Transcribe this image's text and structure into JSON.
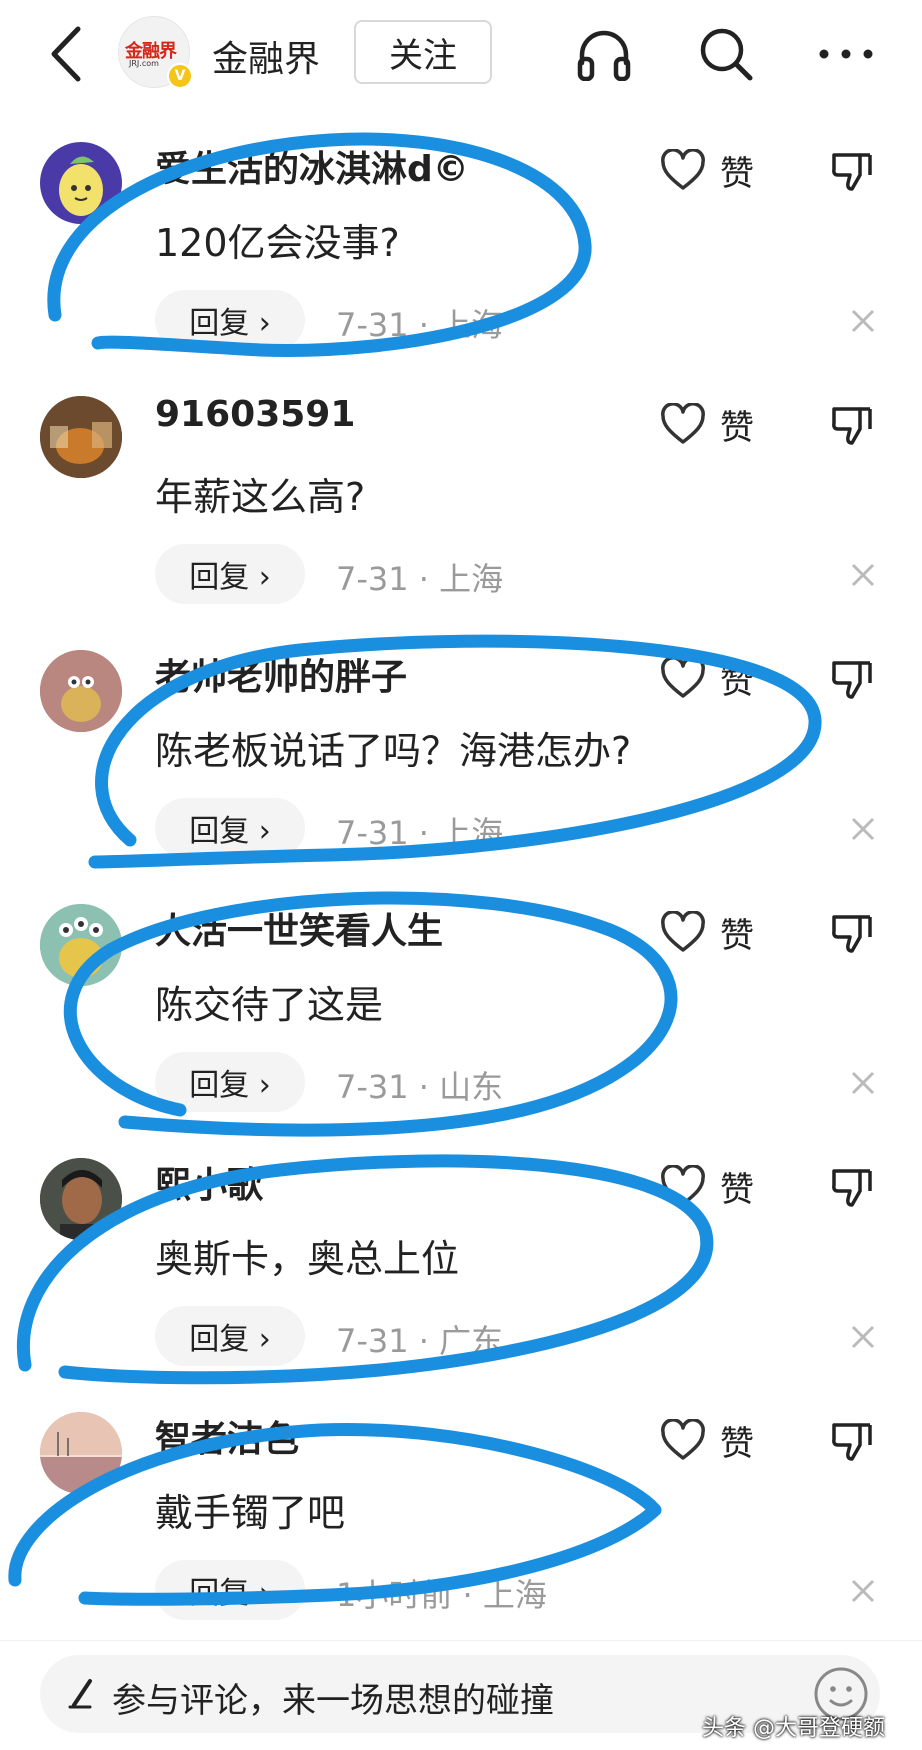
{
  "header": {
    "account_name": "金融界",
    "logo_text": "金融界",
    "logo_sub": "JRJ.com",
    "verified_badge": "V",
    "follow_label": "关注",
    "icons": [
      "back-arrow-icon",
      "headphones-icon",
      "search-icon",
      "more-icon"
    ]
  },
  "comments": [
    {
      "username": "爱生活的冰淇淋d©",
      "content": "120亿会没事?",
      "reply_label": "回复 ›",
      "meta": "7-31 · 上海",
      "like_label": "赞"
    },
    {
      "username": "91603591",
      "content": "年薪这么高?",
      "reply_label": "回复 ›",
      "meta": "7-31 · 上海",
      "like_label": "赞"
    },
    {
      "username": "老帅老帅的胖子",
      "content": "陈老板说话了吗？海港怎办?",
      "reply_label": "回复 ›",
      "meta": "7-31 · 上海",
      "like_label": "赞"
    },
    {
      "username": "人活一世笑看人生",
      "content": "陈交待了这是",
      "reply_label": "回复 ›",
      "meta": "7-31 · 山东",
      "like_label": "赞"
    },
    {
      "username": "熙小歌",
      "content": "奥斯卡，奥总上位",
      "reply_label": "回复 ›",
      "meta": "7-31 · 广东",
      "like_label": "赞"
    },
    {
      "username": "智者洁色",
      "content": "戴手镯了吧",
      "reply_label": "回复 ›",
      "meta": "1小时前 · 上海",
      "like_label": "赞"
    }
  ],
  "bottom_bar": {
    "placeholder": "参与评论，来一场思想的碰撞"
  },
  "watermark": "头条 @大哥登硬额",
  "colors": {
    "annotation_blue": "#1a8fe0",
    "meta_gray": "#9a9a9a",
    "logo_red": "#d3291b",
    "badge_yellow": "#f5c518"
  }
}
